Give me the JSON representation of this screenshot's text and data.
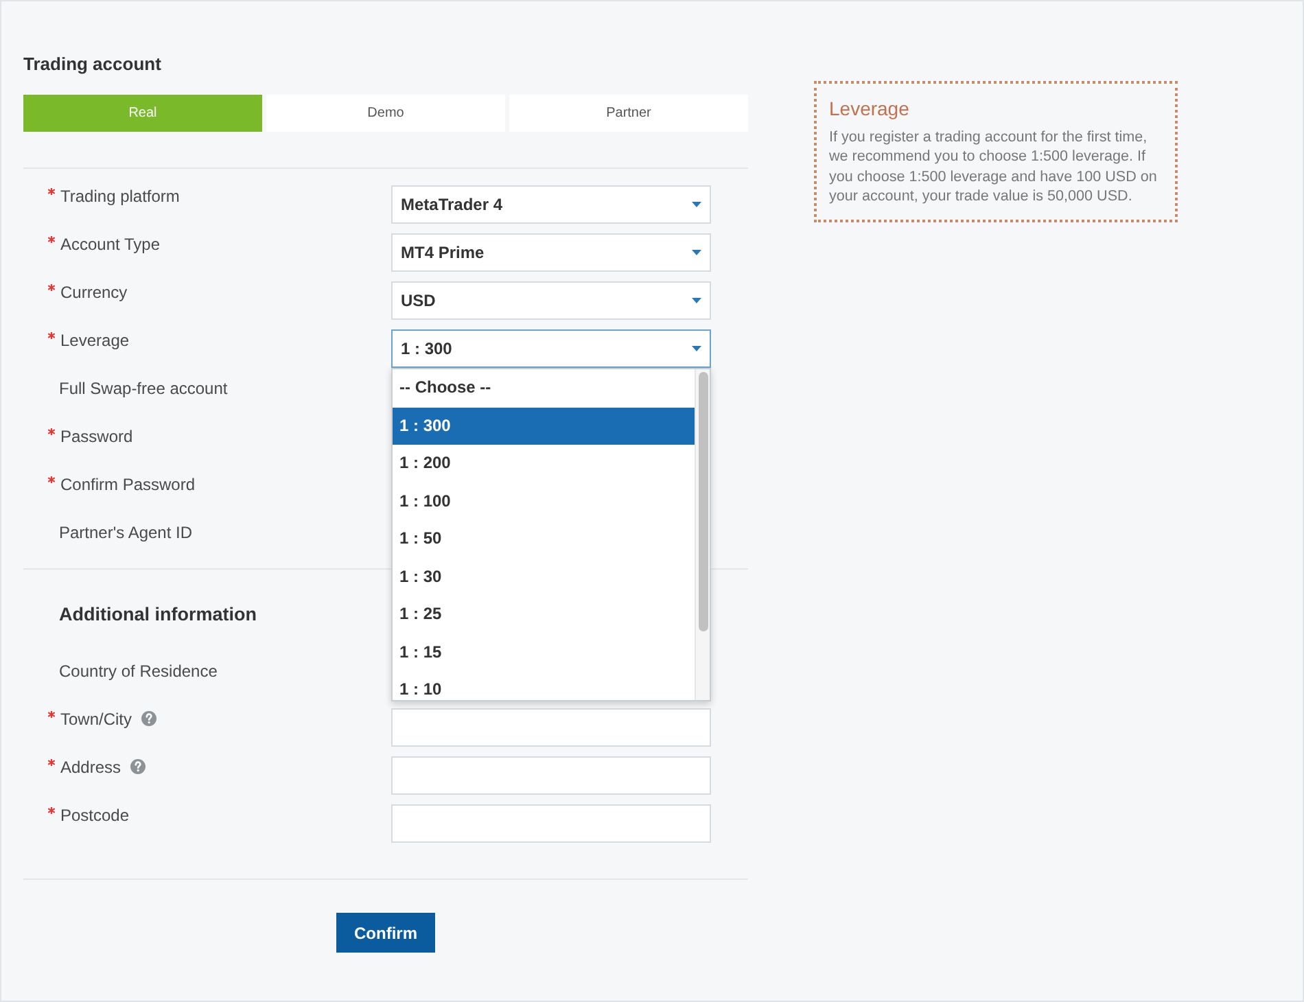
{
  "section_title": "Trading account",
  "tabs": [
    {
      "label": "Real",
      "selected": true
    },
    {
      "label": "Demo",
      "selected": false
    },
    {
      "label": "Partner",
      "selected": false
    }
  ],
  "sections": [
    {
      "fields": [
        {
          "label": "Trading platform",
          "required": true,
          "help": false,
          "kind": "select",
          "value": "MetaTrader 4",
          "focused": false,
          "expanded": false
        },
        {
          "label": "Account Type",
          "required": true,
          "help": false,
          "kind": "select",
          "value": "MT4 Prime",
          "focused": false,
          "expanded": false
        },
        {
          "label": "Currency",
          "required": true,
          "help": false,
          "kind": "select",
          "value": "USD",
          "focused": false,
          "expanded": false
        },
        {
          "label": "Leverage",
          "required": true,
          "help": false,
          "kind": "select",
          "value": "1 : 300",
          "focused": true,
          "expanded": true,
          "options": [
            {
              "label": "-- Choose --",
              "selected": false
            },
            {
              "label": "1 : 300",
              "selected": true
            },
            {
              "label": "1 : 200",
              "selected": false
            },
            {
              "label": "1 : 100",
              "selected": false
            },
            {
              "label": "1 : 50",
              "selected": false
            },
            {
              "label": "1 : 30",
              "selected": false
            },
            {
              "label": "1 : 25",
              "selected": false
            },
            {
              "label": "1 : 15",
              "selected": false
            },
            {
              "label": "1 : 10",
              "selected": false
            }
          ]
        },
        {
          "label": "Full Swap-free account",
          "required": false,
          "help": false,
          "kind": "covered"
        },
        {
          "label": "Password",
          "required": true,
          "help": false,
          "kind": "covered"
        },
        {
          "label": "Confirm Password",
          "required": true,
          "help": false,
          "kind": "covered"
        },
        {
          "label": "Partner's Agent ID",
          "required": false,
          "help": false,
          "kind": "covered"
        }
      ]
    },
    {
      "title": "Additional information",
      "fields": [
        {
          "label": "Country of Residence",
          "required": false,
          "help": false,
          "kind": "covered"
        },
        {
          "label": "Town/City",
          "required": true,
          "help": true,
          "kind": "input",
          "focused": false
        },
        {
          "label": "Address",
          "required": true,
          "help": true,
          "kind": "input",
          "focused": false
        },
        {
          "label": "Postcode",
          "required": true,
          "help": false,
          "kind": "input",
          "focused": false
        }
      ]
    }
  ],
  "confirm_button": "Confirm",
  "info_box": {
    "title": "Leverage",
    "text": "If you register a trading account for the first time, we recommend you to choose 1:500 leverage. If you choose 1:500 leverage and have 100 USD on your account, your trade value is 50,000 USD."
  }
}
